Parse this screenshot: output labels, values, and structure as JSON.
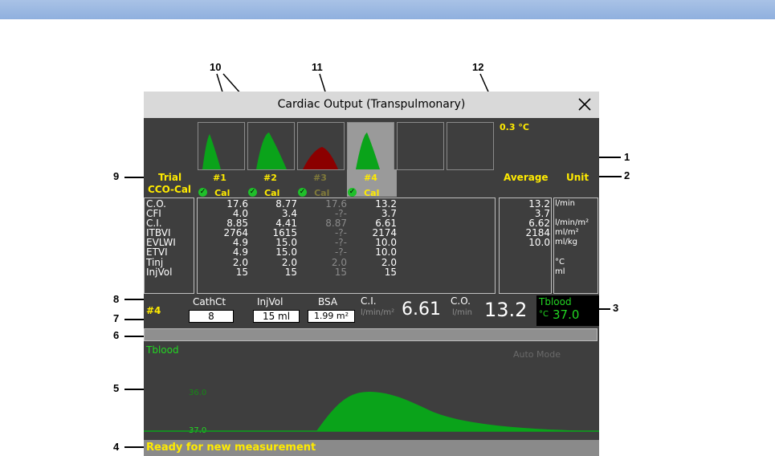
{
  "window": {
    "title": "Cardiac Output (Transpulmonary)",
    "close_icon": "close-icon"
  },
  "thumbnails": [
    {
      "shape": "green-peak-1",
      "selected": false
    },
    {
      "shape": "green-peak-2",
      "selected": false
    },
    {
      "shape": "red-peak",
      "selected": false
    },
    {
      "shape": "green-peak-4",
      "selected": true
    },
    {
      "shape": "empty",
      "selected": false
    },
    {
      "shape": "empty",
      "selected": false
    }
  ],
  "temp_shift": "0.3 °C",
  "header": {
    "trial_label": "Trial",
    "cco_cal_label": "CCO-Cal",
    "average_label": "Average",
    "unit_label": "Unit"
  },
  "trials": [
    {
      "num": "#1",
      "cal": "Cal",
      "excluded": false
    },
    {
      "num": "#2",
      "cal": "Cal",
      "excluded": false
    },
    {
      "num": "#3",
      "cal": "Cal",
      "excluded": true
    },
    {
      "num": "#4",
      "cal": "Cal",
      "excluded": false
    }
  ],
  "params": [
    "C.O.",
    "CFI",
    "C.I.",
    "ITBVI",
    "EVLWI",
    "ETVI",
    "Tinj",
    "InjVol"
  ],
  "trial_values": {
    "t1": [
      "17.6",
      "4.0",
      "8.85",
      "2764",
      "4.9",
      "4.9",
      "2.0",
      "15"
    ],
    "t2": [
      "8.77",
      "3.4",
      "4.41",
      "1615",
      "15.0",
      "15.0",
      "2.0",
      "15"
    ],
    "t3": [
      "17.6",
      "-?-",
      "8.87",
      "-?-",
      "-?-",
      "-?-",
      "2.0",
      "15"
    ],
    "t4": [
      "13.2",
      "3.7",
      "6.61",
      "2174",
      "10.0",
      "10.0",
      "2.0",
      "15"
    ]
  },
  "averages": [
    "13.2",
    "3.7",
    "6.62",
    "2184",
    "10.0"
  ],
  "units": [
    "l/min",
    "",
    "l/min/m²",
    "ml/m²",
    "ml/kg",
    "",
    "°C",
    "ml"
  ],
  "settings": {
    "current_trial": "#4",
    "cathct_label": "CathCt",
    "cathct_value": "8",
    "injvol_label": "InjVol",
    "injvol_value": "15 ml",
    "bsa_label": "BSA",
    "bsa_value": "1.99 m²"
  },
  "results": {
    "ci_label": "C.I.",
    "ci_unit": "l/min/m²",
    "ci_value": "6.61",
    "co_label": "C.O.",
    "co_unit": "l/min",
    "co_value": "13.2",
    "tblood_label": "Tblood",
    "tblood_unit": "°C",
    "tblood_value": "37.0"
  },
  "curve": {
    "label": "Tblood",
    "mode": "Auto Mode",
    "upper_scale": "36.0",
    "baseline_scale": "37.0"
  },
  "status": "Ready for new measurement",
  "callouts": [
    "1",
    "2",
    "3",
    "4",
    "5",
    "6",
    "7",
    "8",
    "9",
    "10",
    "11",
    "12"
  ],
  "colors": {
    "yellow": "#ffeb00",
    "green_curve": "#0aa31a",
    "red_curve": "#8b0000",
    "window_bg": "#3e3e3e"
  }
}
